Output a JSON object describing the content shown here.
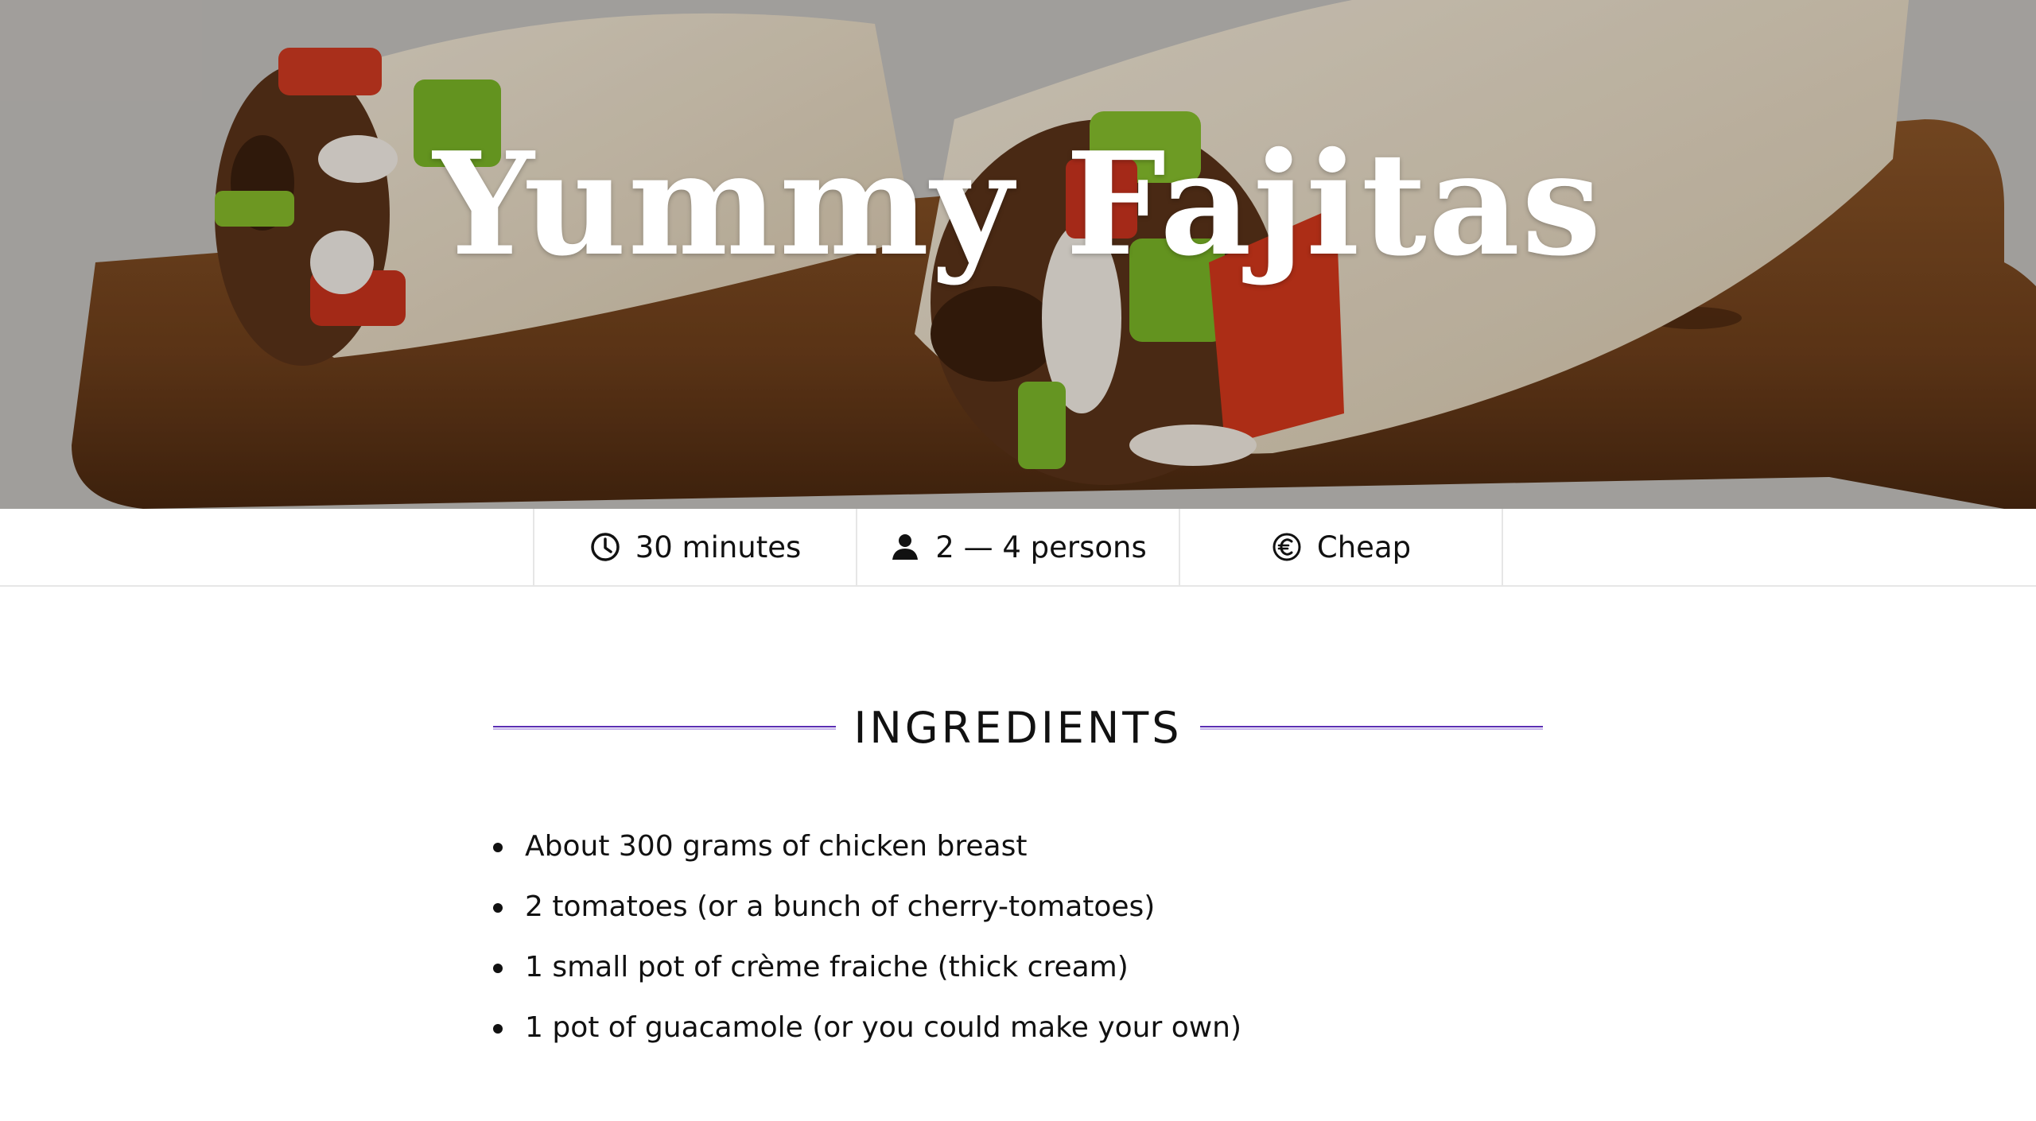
{
  "hero": {
    "title": "Yummy Fajitas"
  },
  "meta": [
    {
      "icon": "clock-icon",
      "label": "30 minutes"
    },
    {
      "icon": "person-icon",
      "label": "2 — 4 persons"
    },
    {
      "icon": "euro-icon",
      "label": "Cheap"
    }
  ],
  "ingredients": {
    "heading": "INGREDIENTS",
    "items": [
      "About 300 grams of chicken breast",
      "2 tomatoes (or a bunch of cherry-tomatoes)",
      "1 small pot of crème fraiche (thick cream)",
      "1 pot of guacamole (or you could make your own)"
    ]
  },
  "colors": {
    "accent_rule": "#5b2fb3",
    "title_text": "#ffffff"
  }
}
